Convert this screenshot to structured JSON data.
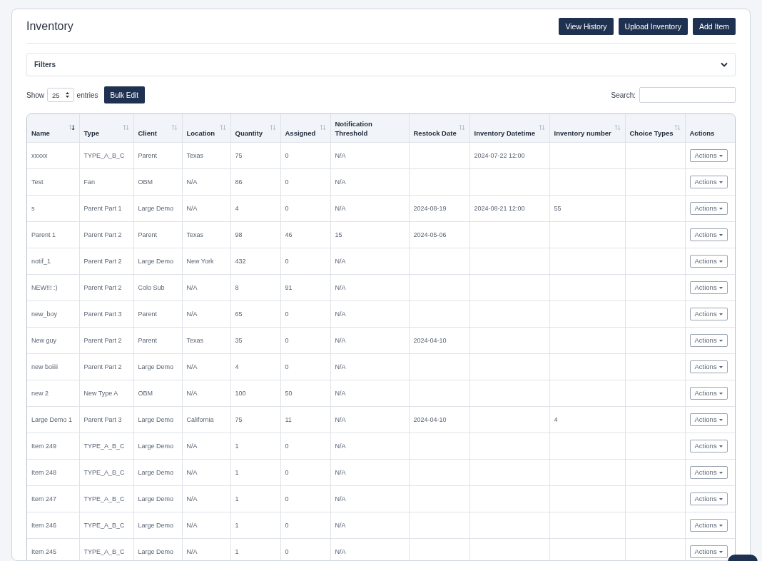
{
  "page": {
    "title": "Inventory",
    "buttons": [
      "View History",
      "Upload Inventory",
      "Add Item"
    ]
  },
  "filters": {
    "label": "Filters",
    "expanded": false
  },
  "toolbar": {
    "show_label": "Show",
    "page_size": "25",
    "entries_label": "entries",
    "bulk_button": "Bulk Edit",
    "search_label": "Search:"
  },
  "table": {
    "columns": [
      {
        "label": "Name",
        "sortable": true,
        "sorted": true
      },
      {
        "label": "Type",
        "sortable": true,
        "sorted": false
      },
      {
        "label": "Client",
        "sortable": true,
        "sorted": false
      },
      {
        "label": "Location",
        "sortable": true,
        "sorted": false
      },
      {
        "label": "Quantity",
        "sortable": true,
        "sorted": false
      },
      {
        "label": "Assigned",
        "sortable": true,
        "sorted": false
      },
      {
        "label": "Notification Threshold",
        "sortable": false
      },
      {
        "label": "Restock Date",
        "sortable": true,
        "sorted": false
      },
      {
        "label": "Inventory Datetime",
        "sortable": true,
        "sorted": false
      },
      {
        "label": "Inventory number",
        "sortable": true,
        "sorted": false
      },
      {
        "label": "Choice Types",
        "sortable": true,
        "sorted": false
      },
      {
        "label": "Actions",
        "sortable": false
      }
    ],
    "rows": [
      {
        "cells": [
          "xxxxx",
          "TYPE_A_B_C",
          "Parent",
          "Texas",
          "75",
          "0",
          "N/A",
          null,
          "2024-07-22 12:00",
          null,
          null
        ],
        "action": "Actions"
      },
      {
        "cells": [
          "Test",
          "Fan",
          "OBM",
          "N/A",
          "86",
          "0",
          "N/A",
          null,
          null,
          null,
          null
        ],
        "action": "Actions"
      },
      {
        "cells": [
          "s",
          "Parent Part 1",
          "Large Demo",
          "N/A",
          "4",
          "0",
          "N/A",
          "2024-08-19",
          "2024-08-21 12:00",
          "55",
          null
        ],
        "action": "Actions"
      },
      {
        "cells": [
          "Parent 1",
          "Parent Part 2",
          "Parent",
          "Texas",
          "98",
          "46",
          "15",
          "2024-05-06",
          null,
          null,
          null
        ],
        "action": "Actions"
      },
      {
        "cells": [
          "notif_1",
          "Parent Part 2",
          "Large Demo",
          "New York",
          "432",
          "0",
          "N/A",
          null,
          null,
          null,
          null
        ],
        "action": "Actions"
      },
      {
        "cells": [
          "NEW!!! :)",
          "Parent Part 2",
          "Colo Sub",
          "N/A",
          "8",
          "91",
          "N/A",
          null,
          null,
          null,
          null
        ],
        "action": "Actions"
      },
      {
        "cells": [
          "new_boy",
          "Parent Part 3",
          "Parent",
          "N/A",
          "65",
          "0",
          "N/A",
          null,
          null,
          null,
          null
        ],
        "action": "Actions"
      },
      {
        "cells": [
          "New guy",
          "Parent Part 2",
          "Parent",
          "Texas",
          "35",
          "0",
          "N/A",
          "2024-04-10",
          null,
          null,
          null
        ],
        "action": "Actions"
      },
      {
        "cells": [
          "new boiiii",
          "Parent Part 2",
          "Large Demo",
          "N/A",
          "4",
          "0",
          "N/A",
          null,
          null,
          null,
          null
        ],
        "action": "Actions"
      },
      {
        "cells": [
          "new 2",
          "New Type A",
          "OBM",
          "N/A",
          "100",
          "50",
          "N/A",
          null,
          null,
          null,
          null
        ],
        "action": "Actions"
      },
      {
        "cells": [
          "Large Demo 1",
          "Parent Part 3",
          "Large Demo",
          "California",
          "75",
          "11",
          "N/A",
          "2024-04-10",
          null,
          "4",
          null
        ],
        "action": "Actions"
      },
      {
        "cells": [
          "Item 249",
          "TYPE_A_B_C",
          "Large Demo",
          "N/A",
          "1",
          "0",
          "N/A",
          null,
          null,
          null,
          null
        ],
        "action": "Actions"
      },
      {
        "cells": [
          "Item 248",
          "TYPE_A_B_C",
          "Large Demo",
          "N/A",
          "1",
          "0",
          "N/A",
          null,
          null,
          null,
          null
        ],
        "action": "Actions"
      },
      {
        "cells": [
          "Item 247",
          "TYPE_A_B_C",
          "Large Demo",
          "N/A",
          "1",
          "0",
          "N/A",
          null,
          null,
          null,
          null
        ],
        "action": "Actions"
      },
      {
        "cells": [
          "Item 246",
          "TYPE_A_B_C",
          "Large Demo",
          "N/A",
          "1",
          "0",
          "N/A",
          null,
          null,
          null,
          null
        ],
        "action": "Actions"
      },
      {
        "cells": [
          "Item 245",
          "TYPE_A_B_C",
          "Large Demo",
          "N/A",
          "1",
          "0",
          "N/A",
          null,
          null,
          null,
          null
        ],
        "action": "Actions"
      }
    ]
  }
}
